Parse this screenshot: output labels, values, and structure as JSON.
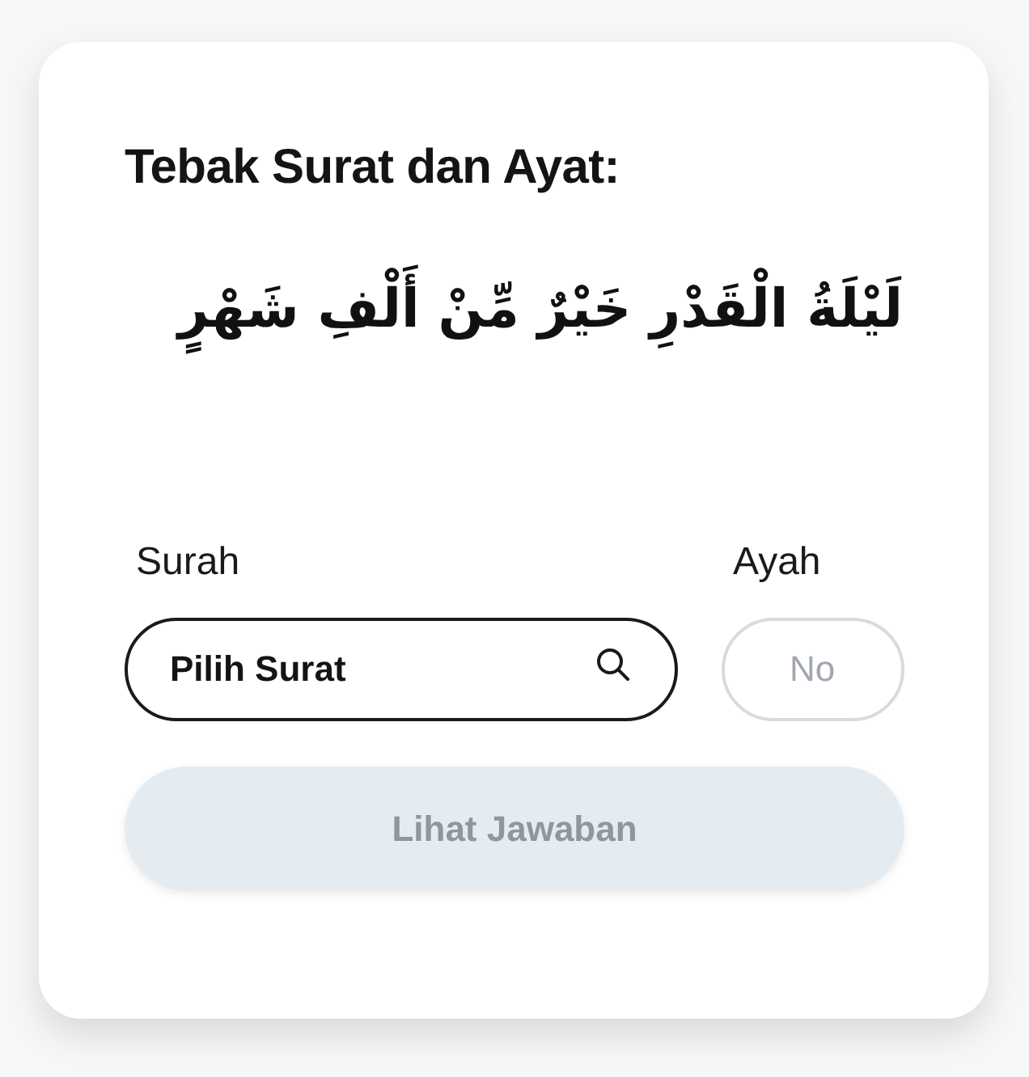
{
  "quiz": {
    "title": "Tebak Surat dan Ayat:",
    "verse": "لَيْلَةُ الْقَدْرِ خَيْرٌ مِّنْ أَلْفِ شَهْرٍ"
  },
  "surah": {
    "label": "Surah",
    "placeholder": "Pilih Surat"
  },
  "ayah": {
    "label": "Ayah",
    "placeholder": "No"
  },
  "submit": {
    "label": "Lihat Jawaban",
    "disabled": true
  }
}
